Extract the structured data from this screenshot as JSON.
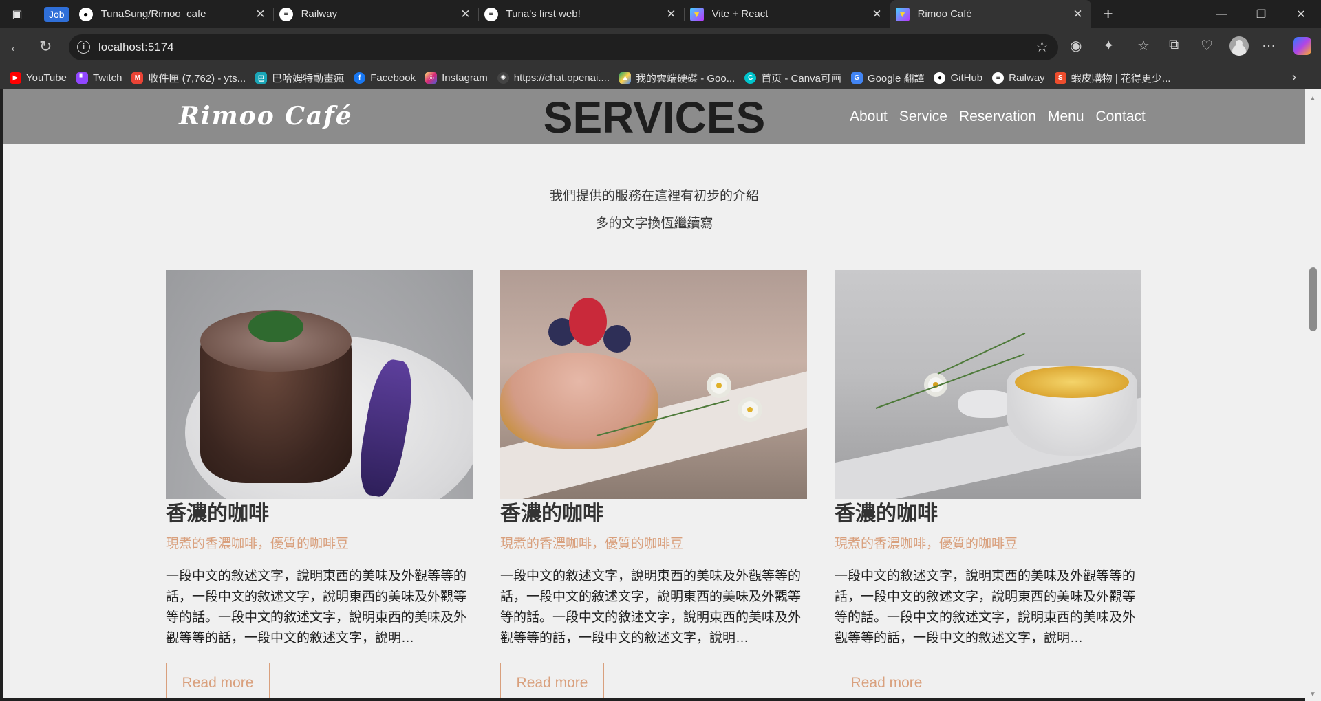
{
  "browser": {
    "badge": "Job",
    "tabs": [
      {
        "title": "TunaSung/Rimoo_cafe",
        "icon": "github-icon",
        "active": false
      },
      {
        "title": "Railway",
        "icon": "railway-icon",
        "active": false
      },
      {
        "title": "Tuna's first web!",
        "icon": "railway-icon",
        "active": false
      },
      {
        "title": "Vite + React",
        "icon": "vite-icon",
        "active": false
      },
      {
        "title": "Rimoo Café",
        "icon": "vite-icon",
        "active": true
      }
    ],
    "url": "localhost:5174",
    "bookmarks": [
      {
        "label": "YouTube",
        "icon": "youtube-icon",
        "color": "#ff0000"
      },
      {
        "label": "Twitch",
        "icon": "twitch-icon",
        "color": "#9146ff"
      },
      {
        "label": "收件匣 (7,762) - yts...",
        "icon": "gmail-icon",
        "color": "#ea4335"
      },
      {
        "label": "巴哈姆特動畫瘋",
        "icon": "bahamut-icon",
        "color": "#1aa6b7"
      },
      {
        "label": "Facebook",
        "icon": "facebook-icon",
        "color": "#1877f2"
      },
      {
        "label": "Instagram",
        "icon": "instagram-icon",
        "color": "#d62976"
      },
      {
        "label": "https://chat.openai....",
        "icon": "openai-icon",
        "color": "#444444"
      },
      {
        "label": "我的雲端硬碟 - Goo...",
        "icon": "google-drive-icon",
        "color": "#1fa463"
      },
      {
        "label": "首页 - Canva可画",
        "icon": "canva-icon",
        "color": "#00c4cc"
      },
      {
        "label": "Google 翻譯",
        "icon": "google-translate-icon",
        "color": "#4285f4"
      },
      {
        "label": "GitHub",
        "icon": "github-icon",
        "color": "#ffffff"
      },
      {
        "label": "Railway",
        "icon": "railway-icon",
        "color": "#ffffff"
      },
      {
        "label": "蝦皮購物 | 花得更少...",
        "icon": "shopee-icon",
        "color": "#ee4d2d"
      }
    ]
  },
  "site": {
    "logo": "Rimoo Café",
    "heading": "SERVICES",
    "nav": [
      "About",
      "Service",
      "Reservation",
      "Menu",
      "Contact"
    ],
    "intro": [
      "我們提供的服務在這裡有初步的介紹",
      "多的文字換恆繼續寫"
    ],
    "accent_color": "#d9a07d",
    "cards": [
      {
        "image": "chocolate-lava-cake-photo",
        "title": "香濃的咖啡",
        "subtitle": "現煮的香濃咖啡，優質的咖啡豆",
        "text": "一段中文的敘述文字，說明東西的美味及外觀等等的話，一段中文的敘述文字，說明東西的美味及外觀等等的話。一段中文的敘述文字，說明東西的美味及外觀等等的話，一段中文的敘述文字，說明…",
        "button": "Read more"
      },
      {
        "image": "berry-tart-photo",
        "title": "香濃的咖啡",
        "subtitle": "現煮的香濃咖啡，優質的咖啡豆",
        "text": "一段中文的敘述文字，說明東西的美味及外觀等等的話，一段中文的敘述文字，說明東西的美味及外觀等等的話。一段中文的敘述文字，說明東西的美味及外觀等等的話，一段中文的敘述文字，說明…",
        "button": "Read more"
      },
      {
        "image": "creme-brulee-photo",
        "title": "香濃的咖啡",
        "subtitle": "現煮的香濃咖啡，優質的咖啡豆",
        "text": "一段中文的敘述文字，說明東西的美味及外觀等等的話，一段中文的敘述文字，說明東西的美味及外觀等等的話。一段中文的敘述文字，說明東西的美味及外觀等等的話，一段中文的敘述文字，說明…",
        "button": "Read more"
      }
    ]
  }
}
